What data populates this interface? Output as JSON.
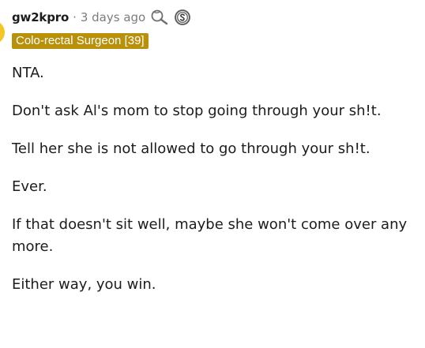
{
  "comment": {
    "author": "gw2kpro",
    "separator": "·",
    "timestamp": "3 days ago",
    "awards": [
      "helpful-award-icon",
      "silver-award-icon"
    ],
    "flair": "Colo-rectal Surgeon [39]",
    "flair_color": "#b8900a",
    "avatar_color": "#f3c623",
    "paragraphs": [
      "NTA.",
      "Don't ask Al's mom to stop going through your sh!t.",
      "Tell her she is not allowed to go through your sh!t.",
      "Ever.",
      "If that doesn't sit well, maybe she won't come over any more.",
      "Either way, you win."
    ]
  }
}
